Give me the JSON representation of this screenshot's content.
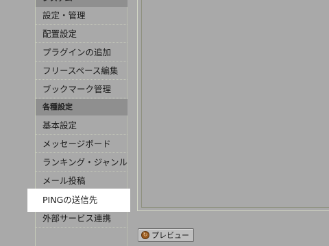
{
  "sidebar": {
    "top_section_label": "システム",
    "group1": [
      "設定・管理",
      "配置設定",
      "プラグインの追加",
      "フリースペース編集",
      "ブックマーク管理"
    ],
    "section2_label": "各種設定",
    "group2": [
      "基本設定",
      "メッセージボード",
      "ランキング・ジャンル",
      "メール投稿",
      "PINGの送信先",
      "外部サービス連携"
    ],
    "highlighted_item": "PINGの送信先"
  },
  "preview_button": {
    "label": "プレビュー",
    "icon": "refresh-icon"
  }
}
